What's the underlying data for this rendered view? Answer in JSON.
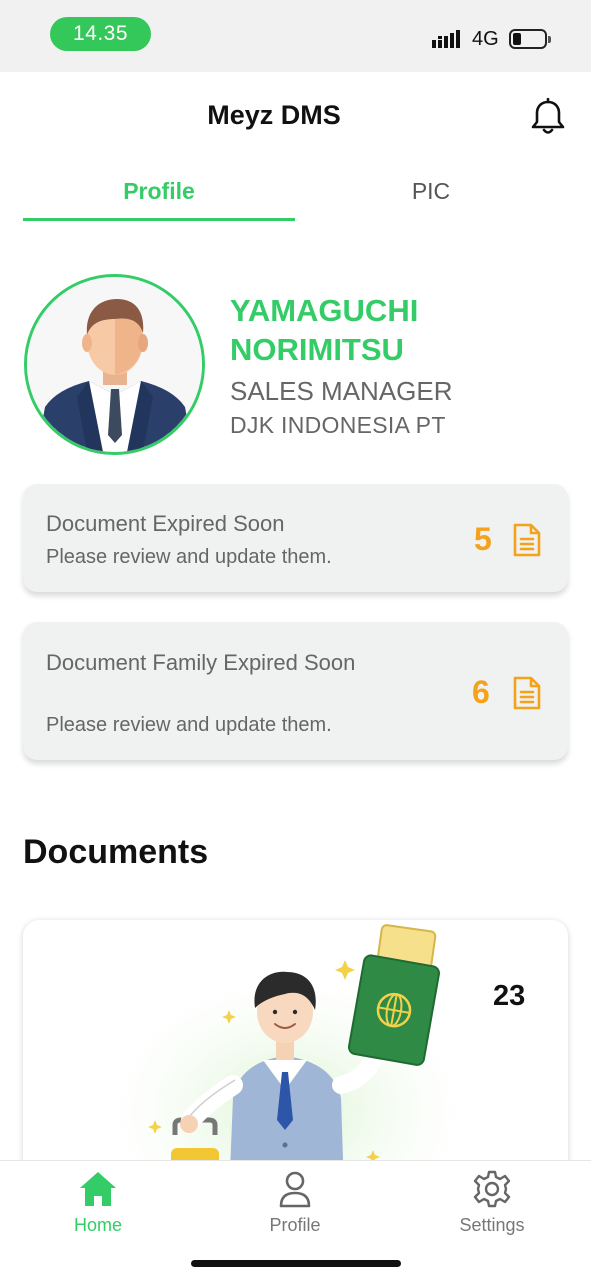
{
  "status_bar": {
    "time": "14.35",
    "network": "4G",
    "battery_icon": "battery-low-icon",
    "signal_icon": "signal-icon"
  },
  "header": {
    "title": "Meyz DMS",
    "notification_icon": "bell-icon"
  },
  "tabs": [
    {
      "label": "Profile",
      "active": true
    },
    {
      "label": "PIC",
      "active": false
    }
  ],
  "profile": {
    "name": "YAMAGUCHI NORIMITSU",
    "position": "SALES MANAGER",
    "company": "DJK INDONESIA PT"
  },
  "alerts": [
    {
      "title": "Document Expired Soon",
      "subtitle": "Please review and update them.",
      "count": "5",
      "icon": "document-icon"
    },
    {
      "title": "Document Family Expired Soon",
      "subtitle": "Please review and update them.",
      "count": "6",
      "icon": "document-icon"
    }
  ],
  "documents": {
    "section_title": "Documents",
    "count": "23"
  },
  "bottom_nav": [
    {
      "label": "Home",
      "icon": "home-icon",
      "active": true
    },
    {
      "label": "Profile",
      "icon": "person-icon",
      "active": false
    },
    {
      "label": "Settings",
      "icon": "gear-icon",
      "active": false
    }
  ],
  "colors": {
    "accent": "#33cc66",
    "warning": "#f5a21b",
    "card_bg": "#eff2f0",
    "status_time_bg": "#34c759"
  }
}
